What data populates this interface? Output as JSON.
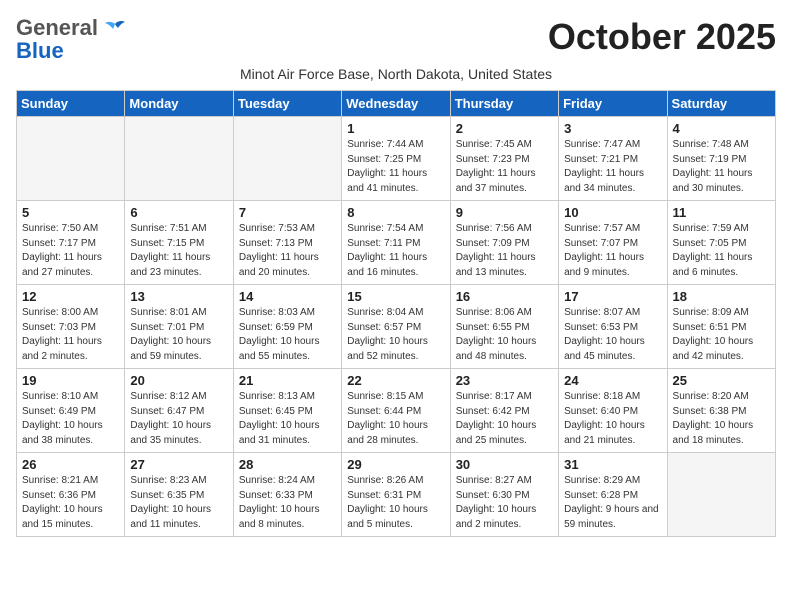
{
  "header": {
    "logo_general": "General",
    "logo_blue": "Blue",
    "month_title": "October 2025",
    "subtitle": "Minot Air Force Base, North Dakota, United States"
  },
  "weekdays": [
    "Sunday",
    "Monday",
    "Tuesday",
    "Wednesday",
    "Thursday",
    "Friday",
    "Saturday"
  ],
  "weeks": [
    [
      {
        "day": "",
        "empty": true
      },
      {
        "day": "",
        "empty": true
      },
      {
        "day": "",
        "empty": true
      },
      {
        "day": "1",
        "sunrise": "7:44 AM",
        "sunset": "7:25 PM",
        "daylight": "11 hours and 41 minutes."
      },
      {
        "day": "2",
        "sunrise": "7:45 AM",
        "sunset": "7:23 PM",
        "daylight": "11 hours and 37 minutes."
      },
      {
        "day": "3",
        "sunrise": "7:47 AM",
        "sunset": "7:21 PM",
        "daylight": "11 hours and 34 minutes."
      },
      {
        "day": "4",
        "sunrise": "7:48 AM",
        "sunset": "7:19 PM",
        "daylight": "11 hours and 30 minutes."
      }
    ],
    [
      {
        "day": "5",
        "sunrise": "7:50 AM",
        "sunset": "7:17 PM",
        "daylight": "11 hours and 27 minutes."
      },
      {
        "day": "6",
        "sunrise": "7:51 AM",
        "sunset": "7:15 PM",
        "daylight": "11 hours and 23 minutes."
      },
      {
        "day": "7",
        "sunrise": "7:53 AM",
        "sunset": "7:13 PM",
        "daylight": "11 hours and 20 minutes."
      },
      {
        "day": "8",
        "sunrise": "7:54 AM",
        "sunset": "7:11 PM",
        "daylight": "11 hours and 16 minutes."
      },
      {
        "day": "9",
        "sunrise": "7:56 AM",
        "sunset": "7:09 PM",
        "daylight": "11 hours and 13 minutes."
      },
      {
        "day": "10",
        "sunrise": "7:57 AM",
        "sunset": "7:07 PM",
        "daylight": "11 hours and 9 minutes."
      },
      {
        "day": "11",
        "sunrise": "7:59 AM",
        "sunset": "7:05 PM",
        "daylight": "11 hours and 6 minutes."
      }
    ],
    [
      {
        "day": "12",
        "sunrise": "8:00 AM",
        "sunset": "7:03 PM",
        "daylight": "11 hours and 2 minutes."
      },
      {
        "day": "13",
        "sunrise": "8:01 AM",
        "sunset": "7:01 PM",
        "daylight": "10 hours and 59 minutes."
      },
      {
        "day": "14",
        "sunrise": "8:03 AM",
        "sunset": "6:59 PM",
        "daylight": "10 hours and 55 minutes."
      },
      {
        "day": "15",
        "sunrise": "8:04 AM",
        "sunset": "6:57 PM",
        "daylight": "10 hours and 52 minutes."
      },
      {
        "day": "16",
        "sunrise": "8:06 AM",
        "sunset": "6:55 PM",
        "daylight": "10 hours and 48 minutes."
      },
      {
        "day": "17",
        "sunrise": "8:07 AM",
        "sunset": "6:53 PM",
        "daylight": "10 hours and 45 minutes."
      },
      {
        "day": "18",
        "sunrise": "8:09 AM",
        "sunset": "6:51 PM",
        "daylight": "10 hours and 42 minutes."
      }
    ],
    [
      {
        "day": "19",
        "sunrise": "8:10 AM",
        "sunset": "6:49 PM",
        "daylight": "10 hours and 38 minutes."
      },
      {
        "day": "20",
        "sunrise": "8:12 AM",
        "sunset": "6:47 PM",
        "daylight": "10 hours and 35 minutes."
      },
      {
        "day": "21",
        "sunrise": "8:13 AM",
        "sunset": "6:45 PM",
        "daylight": "10 hours and 31 minutes."
      },
      {
        "day": "22",
        "sunrise": "8:15 AM",
        "sunset": "6:44 PM",
        "daylight": "10 hours and 28 minutes."
      },
      {
        "day": "23",
        "sunrise": "8:17 AM",
        "sunset": "6:42 PM",
        "daylight": "10 hours and 25 minutes."
      },
      {
        "day": "24",
        "sunrise": "8:18 AM",
        "sunset": "6:40 PM",
        "daylight": "10 hours and 21 minutes."
      },
      {
        "day": "25",
        "sunrise": "8:20 AM",
        "sunset": "6:38 PM",
        "daylight": "10 hours and 18 minutes."
      }
    ],
    [
      {
        "day": "26",
        "sunrise": "8:21 AM",
        "sunset": "6:36 PM",
        "daylight": "10 hours and 15 minutes."
      },
      {
        "day": "27",
        "sunrise": "8:23 AM",
        "sunset": "6:35 PM",
        "daylight": "10 hours and 11 minutes."
      },
      {
        "day": "28",
        "sunrise": "8:24 AM",
        "sunset": "6:33 PM",
        "daylight": "10 hours and 8 minutes."
      },
      {
        "day": "29",
        "sunrise": "8:26 AM",
        "sunset": "6:31 PM",
        "daylight": "10 hours and 5 minutes."
      },
      {
        "day": "30",
        "sunrise": "8:27 AM",
        "sunset": "6:30 PM",
        "daylight": "10 hours and 2 minutes."
      },
      {
        "day": "31",
        "sunrise": "8:29 AM",
        "sunset": "6:28 PM",
        "daylight": "9 hours and 59 minutes."
      },
      {
        "day": "",
        "empty": true
      }
    ]
  ]
}
